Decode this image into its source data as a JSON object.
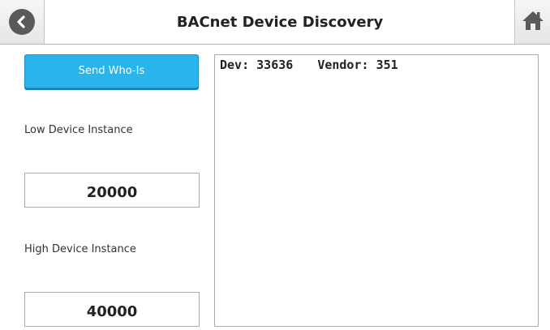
{
  "header": {
    "title": "BACnet Device Discovery",
    "back_icon": "back-arrow-icon",
    "home_icon": "home-icon"
  },
  "controls": {
    "send_label": "Send Who-Is",
    "low_label": "Low Device Instance",
    "low_value": "20000",
    "high_label": "High Device Instance",
    "high_value": "40000"
  },
  "results": [
    {
      "dev_label": "Dev:",
      "dev_value": "33636",
      "vendor_label": "Vendor:",
      "vendor_value": "351"
    }
  ],
  "colors": {
    "accent": "#2ab4ee",
    "header_button": "#e6e6e6"
  }
}
